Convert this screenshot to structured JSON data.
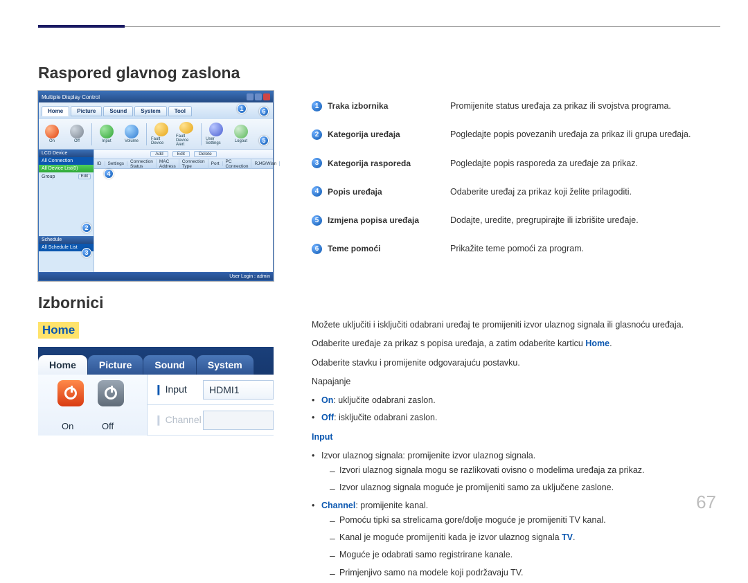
{
  "page_number": "67",
  "heading_layout": "Raspored glavnog zaslona",
  "heading_menus": "Izbornici",
  "heading_home": "Home",
  "app": {
    "title": "Multiple Display Control",
    "menu": [
      "Home",
      "Picture",
      "Sound",
      "System",
      "Tool"
    ],
    "toolbar": [
      "On",
      "Off",
      "Input",
      "Volume",
      "Fault Device",
      "Fault Device Alert",
      "User Settings",
      "Logout"
    ],
    "left": {
      "section1": "LCD Device",
      "row1": "All Connection",
      "section2": "All Device List(0)",
      "group": "Group",
      "edit": "Edit",
      "schedule": "Schedule",
      "schedule_list": "All Schedule List"
    },
    "editbar": [
      "Add",
      "Edit",
      "Delete"
    ],
    "columns": [
      "ID",
      "Settings",
      "Connection Status",
      "MAC Address",
      "Connection Type",
      "Port",
      "PC Connection",
      "RJ45/Wlan"
    ],
    "status": "User Login : admin"
  },
  "legend": [
    {
      "n": "1",
      "key": "Traka izbornika",
      "desc": "Promijenite status uređaja za prikaz ili svojstva programa."
    },
    {
      "n": "2",
      "key": "Kategorija uređaja",
      "desc": "Pogledajte popis povezanih uređaja za prikaz ili grupa uređaja."
    },
    {
      "n": "3",
      "key": "Kategorija rasporeda",
      "desc": "Pogledajte popis rasporeda za uređaje za prikaz."
    },
    {
      "n": "4",
      "key": "Popis uređaja",
      "desc": "Odaberite uređaj za prikaz koji želite prilagoditi."
    },
    {
      "n": "5",
      "key": "Izmjena popisa uređaja",
      "desc": "Dodajte, uredite, pregrupirajte ili izbrišite uređaje."
    },
    {
      "n": "6",
      "key": "Teme pomoći",
      "desc": "Prikažite teme pomoći za program."
    }
  ],
  "home_shot": {
    "tabs": [
      "Home",
      "Picture",
      "Sound",
      "System"
    ],
    "on": "On",
    "off": "Off",
    "row_input_marker": "❙",
    "row_input_label": "Input",
    "row_input_value": "HDMI1",
    "row_channel_label": "Channel"
  },
  "rtext": {
    "p1a": "Možete uključiti i isključiti odabrani uređaj te promijeniti izvor ulaznog signala ili glasnoću uređaja.",
    "p1b_pre": "Odaberite uređaje za prikaz s popisa uređaja, a zatim odaberite karticu ",
    "p1b_kw": "Home",
    "p1b_post": ".",
    "p2": "Odaberite stavku i promijenite odgovarajuću postavku.",
    "nap": "Napajanje",
    "on_kw": "On",
    "on_txt": ": uključite odabrani zaslon.",
    "off_kw": "Off",
    "off_txt": ": isključite odabrani zaslon.",
    "input_h": "Input",
    "inp1": "Izvor ulaznog signala: promijenite izvor ulaznog signala.",
    "inp1a": "Izvori ulaznog signala mogu se razlikovati ovisno o modelima uređaja za prikaz.",
    "inp1b": "Izvor ulaznog signala moguće je promijeniti samo za uključene zaslone.",
    "ch_kw": "Channel",
    "ch_txt": ": promijenite kanal.",
    "ch_a": "Pomoću tipki sa strelicama gore/dolje moguće je promijeniti TV kanal.",
    "ch_b_pre": "Kanal je moguće promijeniti kada je izvor ulaznog signala ",
    "ch_b_kw": "TV",
    "ch_b_post": ".",
    "ch_c": "Moguće je odabrati samo registrirane kanale.",
    "ch_d": "Primjenjivo samo na modele koji podržavaju TV."
  }
}
